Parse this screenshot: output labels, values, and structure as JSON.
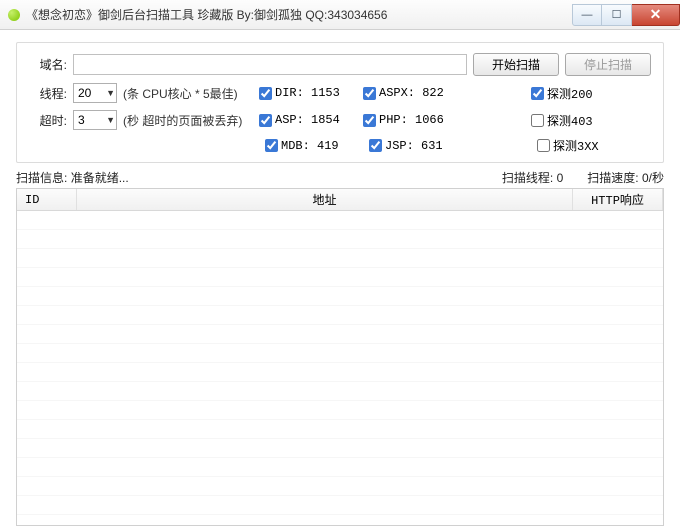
{
  "window": {
    "title": "《想念初恋》御剑后台扫描工具 珍藏版 By:御剑孤独 QQ:343034656"
  },
  "labels": {
    "domain": "域名:",
    "threads": "线程:",
    "timeout": "超时:",
    "thread_hint": "(条 CPU核心 * 5最佳)",
    "timeout_hint": "(秒 超时的页面被丢弃)"
  },
  "buttons": {
    "start": "开始扫描",
    "stop": "停止扫描"
  },
  "inputs": {
    "domain": "",
    "threads": "20",
    "timeout": "3"
  },
  "checks": {
    "dir": {
      "label": "DIR: 1153",
      "checked": true
    },
    "asp": {
      "label": "ASP: 1854",
      "checked": true
    },
    "mdb": {
      "label": "MDB: 419",
      "checked": true
    },
    "aspx": {
      "label": "ASPX: 822",
      "checked": true
    },
    "php": {
      "label": "PHP: 1066",
      "checked": true
    },
    "jsp": {
      "label": "JSP: 631",
      "checked": true
    },
    "p200": {
      "label": "探测200",
      "checked": true
    },
    "p403": {
      "label": "探测403",
      "checked": false
    },
    "p3xx": {
      "label": "探测3XX",
      "checked": false
    }
  },
  "status": {
    "info_label": "扫描信息:",
    "info_value": "准备就绪...",
    "threads_label": "扫描线程:",
    "threads_value": "0",
    "speed_label": "扫描速度:",
    "speed_value": "0/秒"
  },
  "grid": {
    "col_id": "ID",
    "col_addr": "地址",
    "col_http": "HTTP响应"
  }
}
